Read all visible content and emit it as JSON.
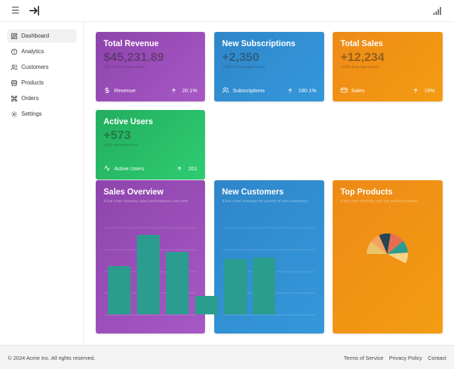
{
  "sidebar": {
    "items": [
      {
        "label": "Dashboard",
        "icon": "grid-icon",
        "active": true
      },
      {
        "label": "Analytics",
        "icon": "info-circle-icon",
        "active": false
      },
      {
        "label": "Customers",
        "icon": "users-icon",
        "active": false
      },
      {
        "label": "Products",
        "icon": "store-icon",
        "active": false
      },
      {
        "label": "Orders",
        "icon": "command-icon",
        "active": false
      },
      {
        "label": "Settings",
        "icon": "gear-icon",
        "active": false
      }
    ]
  },
  "stats": {
    "revenue": {
      "title": "Total Revenue",
      "value": "$45,231.89",
      "sub": "+20.1% from last month",
      "foot_label": "Revenue",
      "foot_value": "20.1%"
    },
    "subscriptions": {
      "title": "New Subscriptions",
      "value": "+2,350",
      "sub": "+180.1% from last month",
      "foot_label": "Subscriptions",
      "foot_value": "180.1%"
    },
    "sales": {
      "title": "Total Sales",
      "value": "+12,234",
      "sub": "+19% from last month",
      "foot_label": "Sales",
      "foot_value": "19%"
    },
    "active": {
      "title": "Active Users",
      "value": "+573",
      "sub": "+201 since last hour",
      "foot_label": "Active Users",
      "foot_value": "201"
    }
  },
  "charts": {
    "sales_overview": {
      "title": "Sales Overview",
      "desc": "A bar chart showing sales performance over time"
    },
    "new_customers": {
      "title": "New Customers",
      "desc": "A line chart showing the growth of new customers"
    },
    "top_products": {
      "title": "Top Products",
      "desc": "A pie chart showing your top selling products"
    }
  },
  "chart_data": [
    {
      "type": "bar",
      "title": "Sales Overview",
      "categories": [
        "",
        "",
        "",
        "",
        "",
        ""
      ],
      "values": [
        68,
        112,
        88,
        26,
        78,
        80
      ],
      "ylim": [
        0,
        130
      ],
      "bar_color": "#2a9d8f"
    },
    {
      "type": "bar",
      "title": "New Customers",
      "categories": [
        "",
        "",
        "",
        "",
        "",
        ""
      ],
      "values": [
        0,
        0,
        0,
        26,
        78,
        80
      ],
      "ylim": [
        0,
        130
      ],
      "bar_color": "#2a9d8f"
    },
    {
      "type": "pie",
      "title": "Top Products",
      "values": [
        18,
        14,
        16,
        20,
        17,
        15
      ],
      "colors": [
        "#e9c46a",
        "#f4a261",
        "#264653",
        "#e76f51",
        "#2a9d8f",
        "#f7d488"
      ]
    }
  ],
  "footer": {
    "copyright": "© 2024 Acme Inc. All rights reserved.",
    "links": [
      "Terms of Service",
      "Privacy Policy",
      "Contact"
    ]
  },
  "colors": {
    "purple": "#9b59b6",
    "blue": "#3498db",
    "orange": "#f39c12",
    "green": "#2ecc71",
    "teal": "#2a9d8f"
  }
}
